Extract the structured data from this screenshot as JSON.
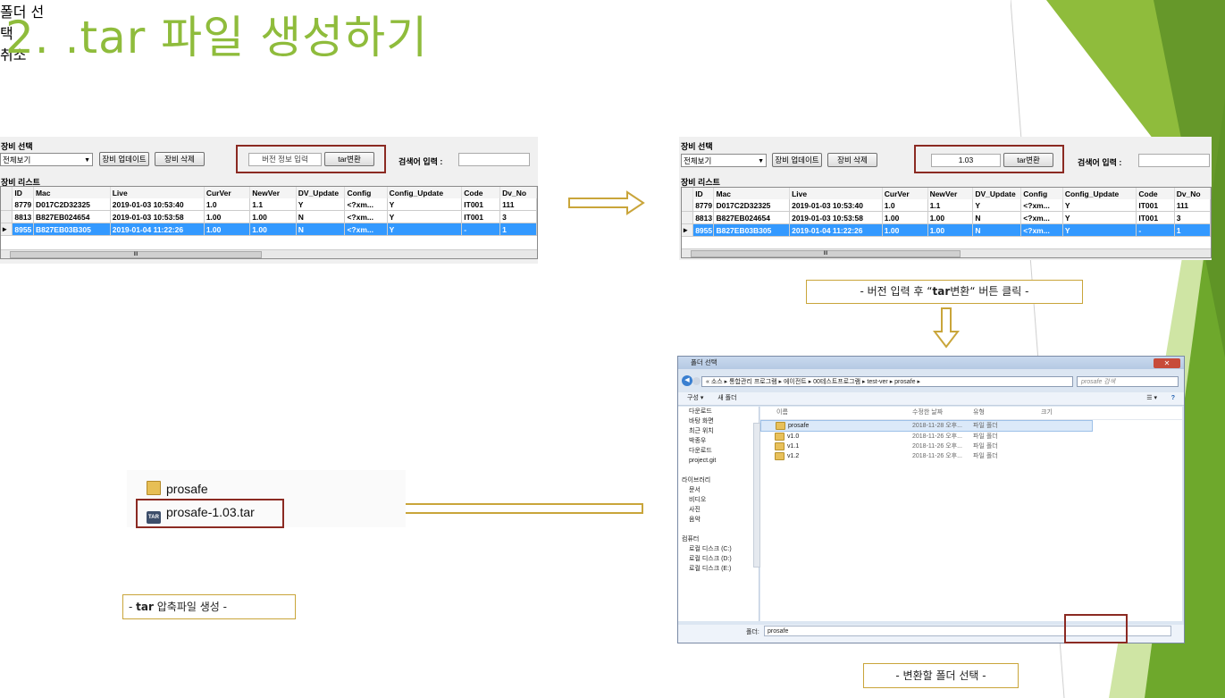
{
  "title": "2. .tar 파일 생성하기",
  "colors": {
    "accent": "#8fbc3c",
    "highlight_border": "#8b2a22",
    "arrow": "#c9a53a",
    "selected_row": "#3399ff"
  },
  "app": {
    "equip_select_label": "장비 선택",
    "combo_value": "전체보기",
    "update_button": "장비 업데이트",
    "delete_button": "장비 삭제",
    "version_placeholder": "버전 정보 입력",
    "version_value": "1.03",
    "tar_button": "tar변환",
    "search_label": "검색어 입력 :",
    "list_label": "장비 리스트",
    "columns": [
      "ID",
      "Mac",
      "Live",
      "CurVer",
      "NewVer",
      "DV_Update",
      "Config",
      "Config_Update",
      "Code",
      "Dv_No"
    ],
    "rows": [
      [
        "8779",
        "D017C2D32325",
        "2019-01-03 10:53:40",
        "1.0",
        "1.1",
        "Y",
        "<?xm...",
        "Y",
        "IT001",
        "111"
      ],
      [
        "8813",
        "B827EB024654",
        "2019-01-03 10:53:58",
        "1.00",
        "1.00",
        "N",
        "<?xm...",
        "Y",
        "IT001",
        "3"
      ],
      [
        "8955",
        "B827EB03B305",
        "2019-01-04 11:22:26",
        "1.00",
        "1.00",
        "N",
        "<?xm...",
        "Y",
        "-",
        "1"
      ]
    ],
    "scroll_thumb_label": "III"
  },
  "captions": {
    "step1_pre": "- 버전 입력 후 “",
    "step1_bold": "tar",
    "step1_post": "변환“ 버튼 클릭 -",
    "step2": "- 변환할 폴더 선택 -",
    "step3_pre": "- ",
    "step3_bold": "tar",
    "step3_post": " 압축파일 생성 -"
  },
  "dialog": {
    "title": "폴더 선택",
    "close": "✕",
    "address": "« 소스 ▸ 통합관리 프로그램 ▸ 에이전트 ▸ 00테스트프로그램 ▸ test-ver ▸ prosafe ▸",
    "search_placeholder": "prosafe 검색",
    "toolbar_organize": "구성 ▾",
    "toolbar_newfolder": "새 폴더",
    "nav": [
      "다운로드",
      "바탕 화면",
      "최근 위치",
      "박종우",
      "다운로드",
      "project.git",
      "",
      "라이브러리",
      "문서",
      "비디오",
      "사진",
      "음악",
      "",
      "컴퓨터",
      "로컬 디스크 (C:)",
      "로컬 디스크 (D:)",
      "로컬 디스크 (E:)"
    ],
    "headers": {
      "name": "이름",
      "date": "수정한 날짜",
      "type": "유형",
      "size": "크기"
    },
    "files": [
      {
        "name": "prosafe",
        "date": "2018-11-28 오후...",
        "type": "파일 폴더"
      },
      {
        "name": "v1.0",
        "date": "2018-11-26 오후...",
        "type": "파일 폴더"
      },
      {
        "name": "v1.1",
        "date": "2018-11-26 오후...",
        "type": "파일 폴더"
      },
      {
        "name": "v1.2",
        "date": "2018-11-26 오후...",
        "type": "파일 폴더"
      }
    ],
    "folder_label": "폴더:",
    "folder_value": "prosafe",
    "select_button": "폴더 선택",
    "cancel_button": "취소"
  },
  "output": {
    "folder_name": "prosafe",
    "tar_name": "prosafe-1.03.tar",
    "tar_icon_text": "TAR"
  }
}
